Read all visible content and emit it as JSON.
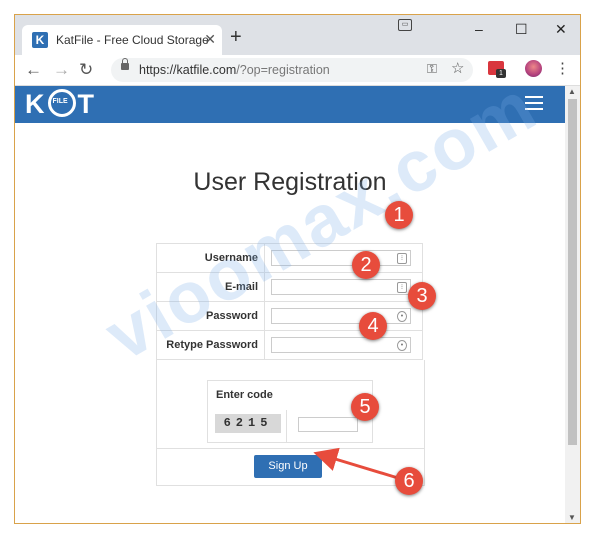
{
  "browser": {
    "tab_title": "KatFile - Free Cloud Storage",
    "tab_favicon": "K",
    "url_host": "https://katfile.com",
    "url_path": "/?op=registration",
    "window_controls": [
      "–",
      "☐",
      "✕"
    ],
    "extension_badge": "1"
  },
  "site": {
    "logo_letters_left": "K",
    "logo_o_text": "FILE",
    "logo_letters_right": "T",
    "heading": "User Registration"
  },
  "form": {
    "fields": [
      {
        "label": "Username",
        "value": ""
      },
      {
        "label": "E-mail",
        "value": ""
      },
      {
        "label": "Password",
        "value": ""
      },
      {
        "label": "Retype Password",
        "value": ""
      }
    ],
    "captcha": {
      "title": "Enter code",
      "code": "6215",
      "input_value": ""
    },
    "submit_label": "Sign Up"
  },
  "annotations": {
    "watermark": "vioomax.com",
    "callouts": [
      "1",
      "2",
      "3",
      "4",
      "5",
      "6"
    ],
    "callout_color": "#e74c3c"
  },
  "colors": {
    "brand": "#2f6fb3",
    "frame_border": "#d9a24a"
  }
}
